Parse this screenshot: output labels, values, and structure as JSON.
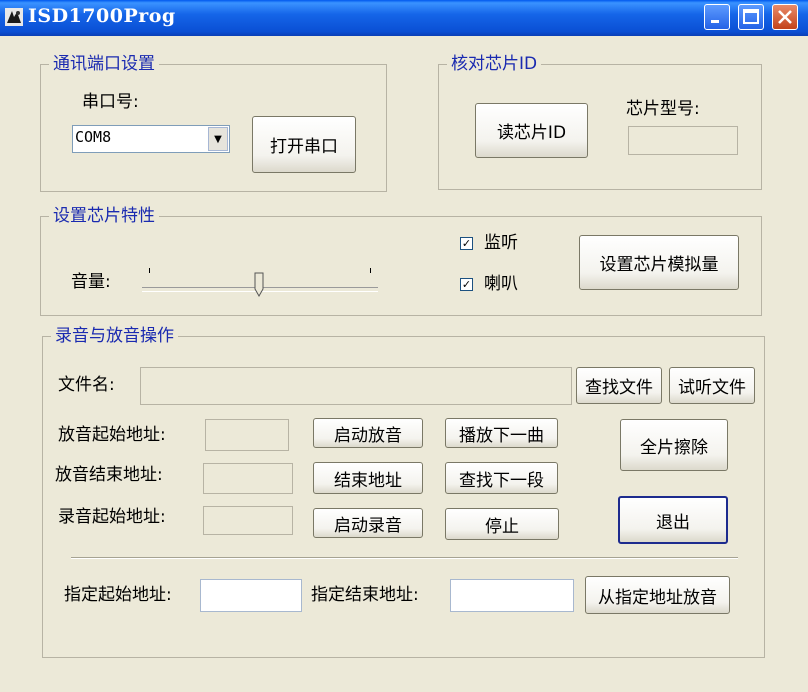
{
  "window": {
    "title": "ISD1700Prog"
  },
  "comm": {
    "group_title": "通讯端口设置",
    "port_label": "串口号:",
    "port_value": "COM8",
    "open_button": "打开串口"
  },
  "chip_id": {
    "group_title": "核对芯片ID",
    "read_button": "读芯片ID",
    "model_label": "芯片型号:",
    "model_value": ""
  },
  "chip_props": {
    "group_title": "设置芯片特性",
    "volume_label": "音量:",
    "volume_level_fraction": 0.5,
    "monitor_label": "监听",
    "monitor_checked": true,
    "speaker_label": "喇叭",
    "speaker_checked": true,
    "set_button": "设置芯片模拟量"
  },
  "record": {
    "group_title": "录音与放音操作",
    "file_label": "文件名:",
    "file_value": "",
    "find_file_button": "查找文件",
    "listen_file_button": "试听文件",
    "play_start_label": "放音起始地址:",
    "play_end_label": "放音结束地址:",
    "rec_start_label": "录音起始地址:",
    "start_play_button": "启动放音",
    "end_addr_button": "结束地址",
    "start_rec_button": "启动录音",
    "next_track_button": "播放下一曲",
    "find_next_button": "查找下一段",
    "stop_button": "停止",
    "erase_button": "全片擦除",
    "exit_button": "退出",
    "spec_start_label": "指定起始地址:",
    "spec_end_label": "指定结束地址:",
    "spec_start_value": "",
    "spec_end_value": "",
    "play_from_button": "从指定地址放音"
  }
}
